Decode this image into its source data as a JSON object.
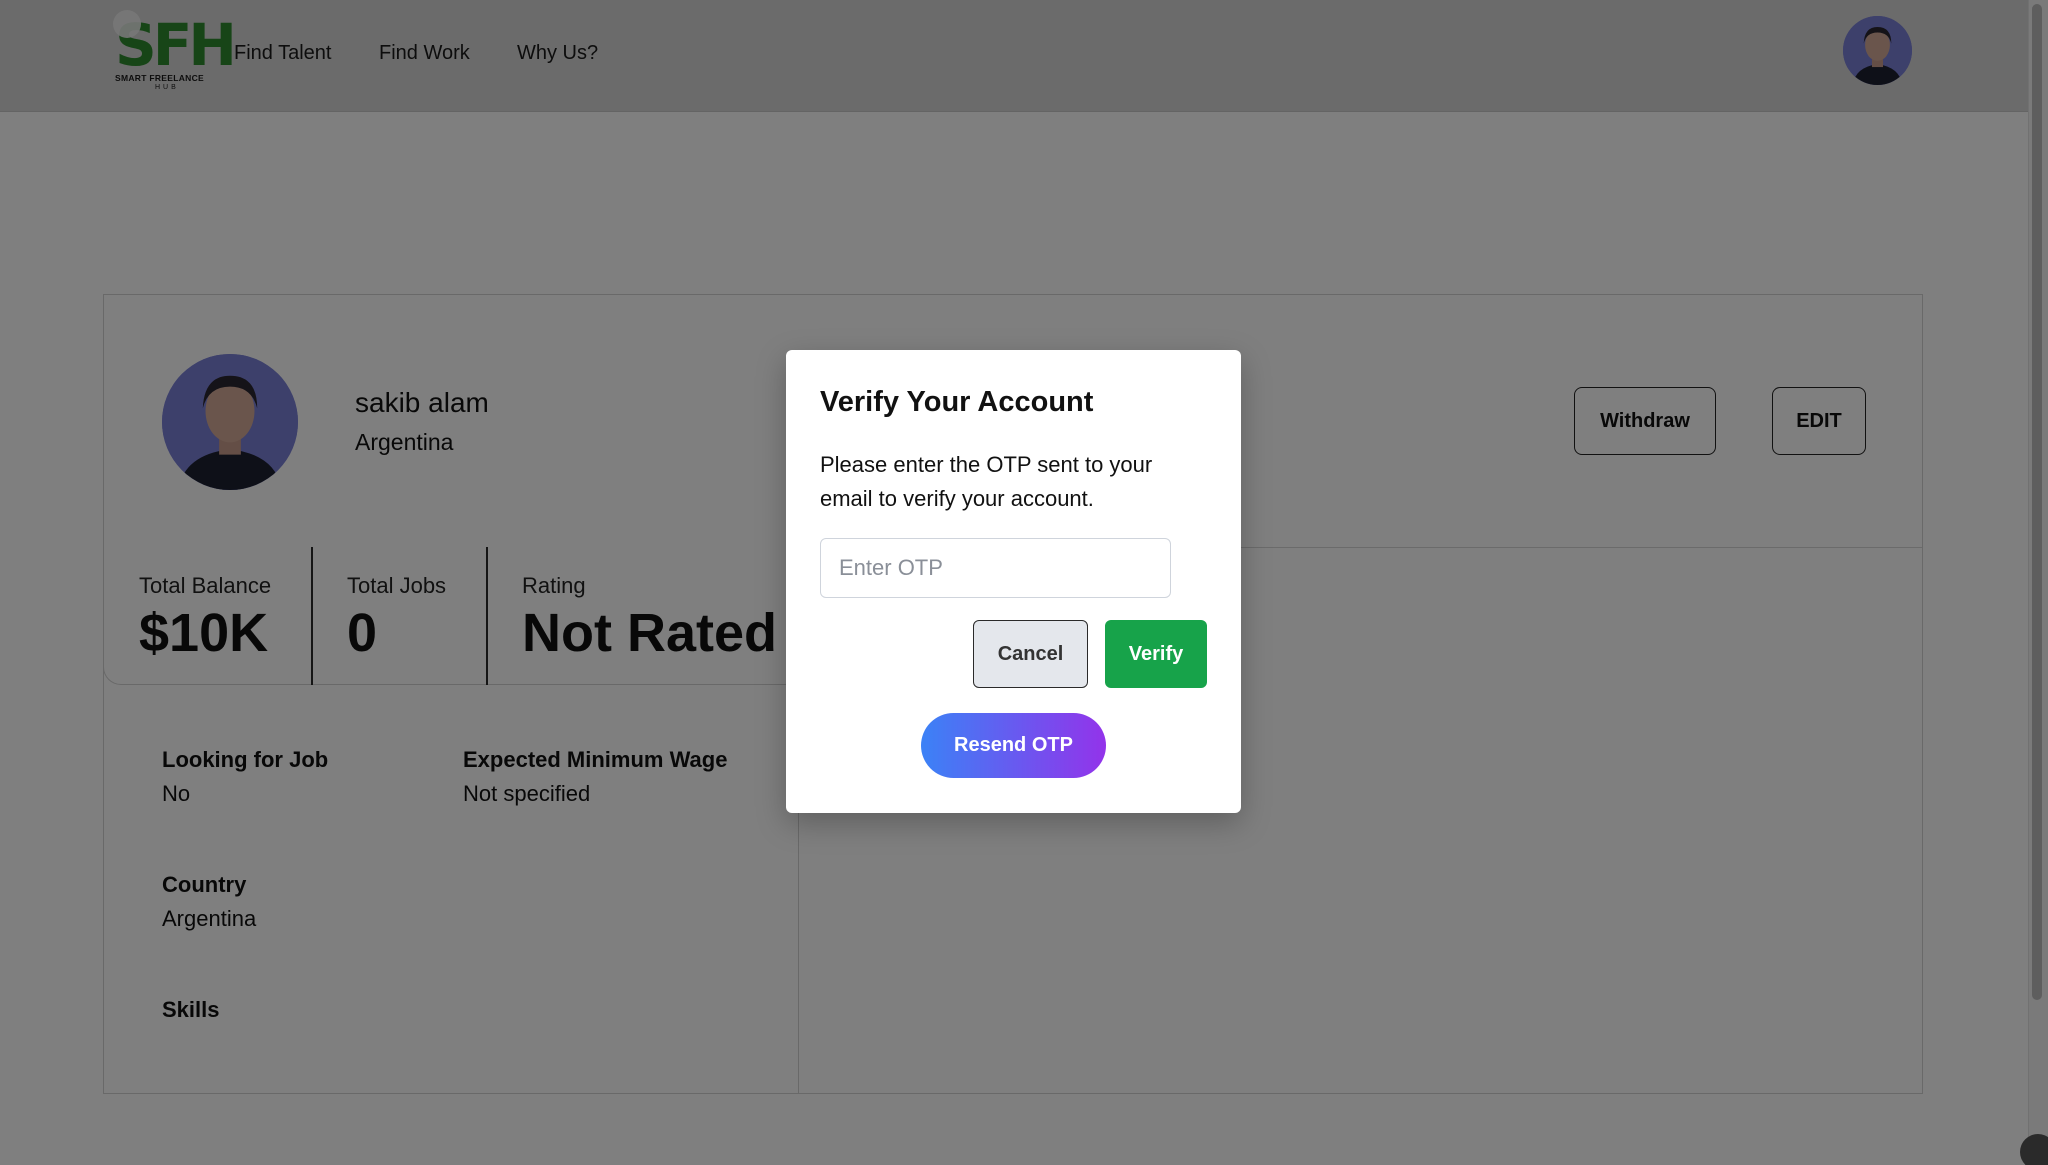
{
  "nav": {
    "logo_letters": "SFH",
    "logo_tagline": "SMART FREELANCE",
    "logo_hub": "HUB",
    "links": [
      "Find Talent",
      "Find Work",
      "Why Us?"
    ]
  },
  "profile": {
    "name": "sakib alam",
    "country": "Argentina",
    "withdraw_label": "Withdraw",
    "edit_label": "EDIT",
    "stats": [
      {
        "label": "Total Balance",
        "value": "$10K"
      },
      {
        "label": "Total Jobs",
        "value": "0"
      },
      {
        "label": "Rating",
        "value": "Not Rated"
      }
    ],
    "details": {
      "looking_label": "Looking for Job",
      "looking_value": "No",
      "wage_label": "Expected Minimum Wage",
      "wage_value": "Not specified",
      "country_label": "Country",
      "country_value": "Argentina",
      "skills_label": "Skills"
    }
  },
  "modal": {
    "title": "Verify Your Account",
    "message": "Please enter the OTP sent to your email to verify your account.",
    "otp_placeholder": "Enter OTP",
    "otp_value": "",
    "cancel_label": "Cancel",
    "verify_label": "Verify",
    "resend_label": "Resend OTP"
  },
  "colors": {
    "logo_green": "#2f8a2f",
    "verify_green": "#17a34a",
    "resend_gradient_start": "#3b82f6",
    "resend_gradient_end": "#9333ea",
    "overlay": "rgba(0,0,0,0.5)"
  }
}
